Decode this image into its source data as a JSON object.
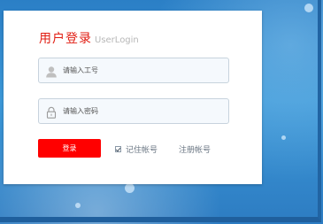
{
  "login": {
    "title": "用户登录",
    "subtitle": "UserLogin",
    "username_placeholder": "请输入工号",
    "password_placeholder": "请输入密码",
    "submit_label": "登录",
    "remember_label": "记住帐号",
    "register_label": "注册帐号"
  },
  "icons": {
    "username": "user-icon",
    "password": "lock-icon",
    "remember": "checkbox-checked-icon"
  },
  "colors": {
    "accent": "#e11d12",
    "button": "#ff0000",
    "background": "#3c98d8"
  }
}
